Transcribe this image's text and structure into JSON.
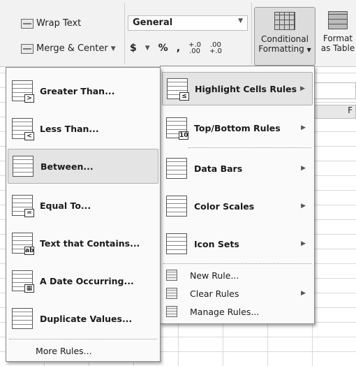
{
  "ribbon": {
    "wrap_text": "Wrap Text",
    "merge_center": "Merge & Center",
    "number_format": "General",
    "currency": "$",
    "percent": "%",
    "comma": ",",
    "inc_decimal": "+.0\n.00",
    "dec_decimal": ".00\n+.0",
    "conditional_formatting_line1": "Conditional",
    "conditional_formatting_line2": "Formatting",
    "format_table_line1": "Format",
    "format_table_line2": "as Table"
  },
  "sheet": {
    "column_header": "F"
  },
  "main_menu": {
    "items": [
      {
        "label": "Highlight Cells Rules",
        "icon": "highlight-cells-icon",
        "submenu": true
      },
      {
        "label": "Top/Bottom Rules",
        "icon": "top-bottom-icon",
        "submenu": true
      },
      {
        "label": "Data Bars",
        "icon": "data-bars-icon",
        "submenu": true
      },
      {
        "label": "Color Scales",
        "icon": "color-scales-icon",
        "submenu": true
      },
      {
        "label": "Icon Sets",
        "icon": "icon-sets-icon",
        "submenu": true
      },
      {
        "label": "New Rule...",
        "icon": "new-rule-icon",
        "submenu": false
      },
      {
        "label": "Clear Rules",
        "icon": "clear-rules-icon",
        "submenu": true
      },
      {
        "label": "Manage Rules...",
        "icon": "manage-rules-icon",
        "submenu": false
      }
    ]
  },
  "sub_menu": {
    "items": [
      {
        "label": "Greater Than...",
        "badge": ">"
      },
      {
        "label": "Less Than...",
        "badge": "<"
      },
      {
        "label": "Between...",
        "badge": ""
      },
      {
        "label": "Equal To...",
        "badge": "="
      },
      {
        "label": "Text that Contains...",
        "badge": "ab"
      },
      {
        "label": "A Date Occurring...",
        "badge": "▦"
      },
      {
        "label": "Duplicate Values...",
        "badge": ""
      }
    ],
    "more_rules": "More Rules..."
  }
}
